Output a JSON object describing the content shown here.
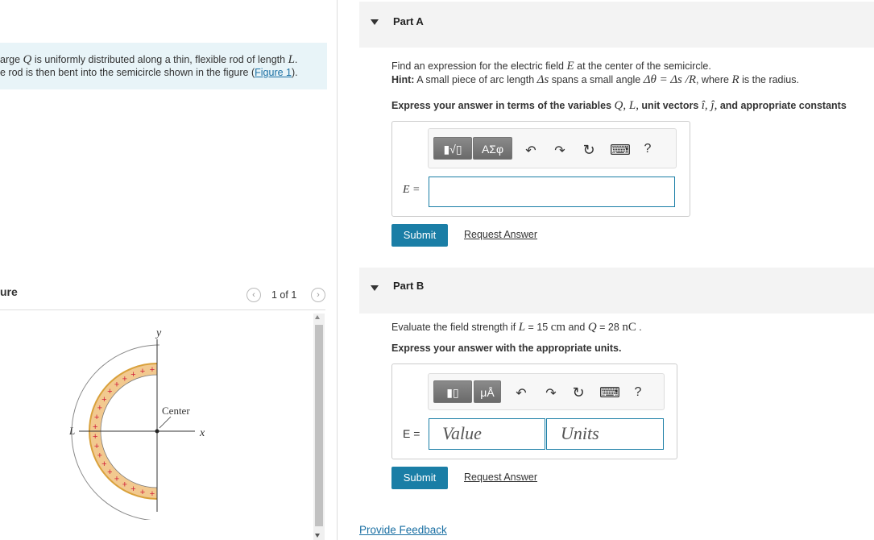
{
  "problem": {
    "intro_line1_pre": "arge ",
    "intro_var_q": "Q",
    "intro_line1_mid": " is uniformly distributed along a thin, flexible rod of length ",
    "intro_var_l": "L",
    "intro_line1_end": ".",
    "intro_line2_pre": "e rod is then bent into the semicircle shown in the figure (",
    "intro_link": "Figure 1",
    "intro_line2_end": ")."
  },
  "figure": {
    "header": "ure",
    "pager": "1 of 1",
    "prev_icon": "‹",
    "next_icon": "›",
    "label_y": "y",
    "label_x": "x",
    "label_l": "L",
    "label_center": "Center",
    "plus": "+"
  },
  "part_a": {
    "title": "Part A",
    "q_pre": "Find an expression for the electric field ",
    "q_var": "E",
    "q_post": " at the center of the semicircle.",
    "hint_label": "Hint:",
    "hint_pre": " A small piece of arc length ",
    "hint_ds": "Δs",
    "hint_mid": " spans a small angle ",
    "hint_eq": "Δθ = Δs /R",
    "hint_mid2": ", where ",
    "hint_r": "R",
    "hint_post": " is the radius.",
    "instr_pre": "Express your answer in terms of the variables ",
    "instr_vars": "Q, L,",
    "instr_mid": " unit vectors ",
    "instr_units": "î,  ĵ,",
    "instr_post": " and appropriate constants",
    "toolbar_math": "▮√▯",
    "toolbar_greek": "ΑΣφ",
    "toolbar_undo": "↶",
    "toolbar_redo": "↷",
    "toolbar_reset": "↻",
    "toolbar_keyboard": "⌨",
    "toolbar_help": "?",
    "answer_label": "E =",
    "submit": "Submit",
    "request": "Request Answer"
  },
  "part_b": {
    "title": "Part B",
    "q_pre": "Evaluate the field strength if ",
    "q_l": "L",
    "q_mid1": " = 15 ",
    "q_cm": "cm",
    "q_mid2": " and ",
    "q_q": "Q",
    "q_mid3": " = 28 ",
    "q_nc": "nC",
    "q_post": " .",
    "instr": "Express your answer with the appropriate units.",
    "toolbar_templates": "▮▯",
    "toolbar_units": "μÅ",
    "toolbar_undo": "↶",
    "toolbar_redo": "↷",
    "toolbar_reset": "↻",
    "toolbar_keyboard": "⌨",
    "toolbar_help": "?",
    "answer_label": "E =",
    "value_placeholder": "Value",
    "units_placeholder": "Units",
    "submit": "Submit",
    "request": "Request Answer"
  },
  "footer": {
    "feedback": "Provide Feedback"
  }
}
